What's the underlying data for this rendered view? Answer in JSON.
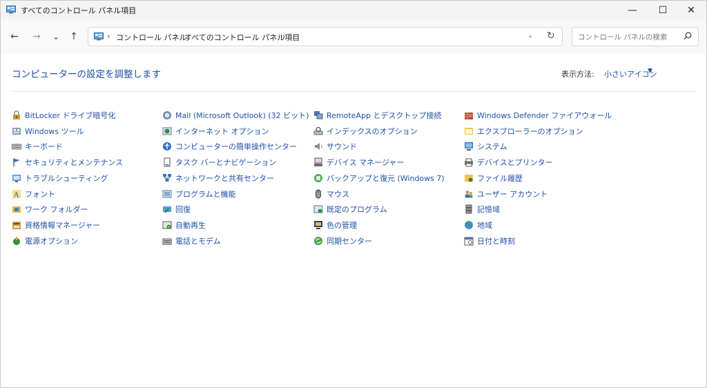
{
  "window": {
    "title": "すべてのコントロール パネル項目",
    "controls": {
      "minimize": "—",
      "maximize": "☐",
      "close": "✕"
    }
  },
  "nav": {
    "back": "←",
    "forward": "→",
    "recent": "⌄",
    "up": "↑",
    "breadcrumbs": [
      "コントロール パネル",
      "すべてのコントロール パネル項目"
    ],
    "separator": "›",
    "search_placeholder": "コントロール パネルの検索"
  },
  "main": {
    "heading": "コンピューターの設定を調整します",
    "view_by_label": "表示方法:",
    "view_by_value": "小さいアイコン"
  },
  "items": [
    {
      "label": "BitLocker ドライブ暗号化",
      "icon": "bitlocker-icon",
      "col": 0,
      "row": 0
    },
    {
      "label": "Windows ツール",
      "icon": "windows-tools-icon",
      "col": 0,
      "row": 1
    },
    {
      "label": "キーボード",
      "icon": "keyboard-icon",
      "col": 0,
      "row": 2
    },
    {
      "label": "セキュリティとメンテナンス",
      "icon": "flag-icon",
      "col": 0,
      "row": 3
    },
    {
      "label": "トラブルシューティング",
      "icon": "troubleshoot-icon",
      "col": 0,
      "row": 4
    },
    {
      "label": "フォント",
      "icon": "font-icon",
      "col": 0,
      "row": 5
    },
    {
      "label": "ワーク フォルダー",
      "icon": "work-folders-icon",
      "col": 0,
      "row": 6
    },
    {
      "label": "資格情報マネージャー",
      "icon": "credential-manager-icon",
      "col": 0,
      "row": 7
    },
    {
      "label": "電源オプション",
      "icon": "power-options-icon",
      "col": 0,
      "row": 8
    },
    {
      "label": "Mail (Microsoft Outlook) (32 ビット)",
      "icon": "mail-icon",
      "col": 1,
      "row": 0
    },
    {
      "label": "インターネット オプション",
      "icon": "internet-options-icon",
      "col": 1,
      "row": 1
    },
    {
      "label": "コンピューターの簡単操作センター",
      "icon": "ease-of-access-icon",
      "col": 1,
      "row": 2
    },
    {
      "label": "タスク バーとナビゲーション",
      "icon": "taskbar-icon",
      "col": 1,
      "row": 3
    },
    {
      "label": "ネットワークと共有センター",
      "icon": "network-icon",
      "col": 1,
      "row": 4
    },
    {
      "label": "プログラムと機能",
      "icon": "programs-icon",
      "col": 1,
      "row": 5
    },
    {
      "label": "回復",
      "icon": "recovery-icon",
      "col": 1,
      "row": 6
    },
    {
      "label": "自動再生",
      "icon": "autoplay-icon",
      "col": 1,
      "row": 7
    },
    {
      "label": "電話とモデム",
      "icon": "phone-modem-icon",
      "col": 1,
      "row": 8
    },
    {
      "label": "RemoteApp とデスクトップ接続",
      "icon": "remoteapp-icon",
      "col": 2,
      "row": 0
    },
    {
      "label": "インデックスのオプション",
      "icon": "indexing-icon",
      "col": 2,
      "row": 1
    },
    {
      "label": "サウンド",
      "icon": "sound-icon",
      "col": 2,
      "row": 2
    },
    {
      "label": "デバイス マネージャー",
      "icon": "device-manager-icon",
      "col": 2,
      "row": 3
    },
    {
      "label": "バックアップと復元 (Windows 7)",
      "icon": "backup-icon",
      "col": 2,
      "row": 4
    },
    {
      "label": "マウス",
      "icon": "mouse-icon",
      "col": 2,
      "row": 5
    },
    {
      "label": "既定のプログラム",
      "icon": "default-programs-icon",
      "col": 2,
      "row": 6
    },
    {
      "label": "色の管理",
      "icon": "color-management-icon",
      "col": 2,
      "row": 7
    },
    {
      "label": "同期センター",
      "icon": "sync-center-icon",
      "col": 2,
      "row": 8
    },
    {
      "label": "Windows Defender ファイアウォール",
      "icon": "firewall-icon",
      "col": 3,
      "row": 0
    },
    {
      "label": "エクスプローラーのオプション",
      "icon": "explorer-options-icon",
      "col": 3,
      "row": 1
    },
    {
      "label": "システム",
      "icon": "system-icon",
      "col": 3,
      "row": 2
    },
    {
      "label": "デバイスとプリンター",
      "icon": "printer-icon",
      "col": 3,
      "row": 3
    },
    {
      "label": "ファイル履歴",
      "icon": "file-history-icon",
      "col": 3,
      "row": 4
    },
    {
      "label": "ユーザー アカウント",
      "icon": "user-accounts-icon",
      "col": 3,
      "row": 5
    },
    {
      "label": "記憶域",
      "icon": "storage-icon",
      "col": 3,
      "row": 6
    },
    {
      "label": "地域",
      "icon": "region-icon",
      "col": 3,
      "row": 7
    },
    {
      "label": "日付と時刻",
      "icon": "date-time-icon",
      "col": 3,
      "row": 8
    }
  ],
  "colors": {
    "link": "#1e4fa8",
    "titlebar": "#f3f3f3"
  }
}
